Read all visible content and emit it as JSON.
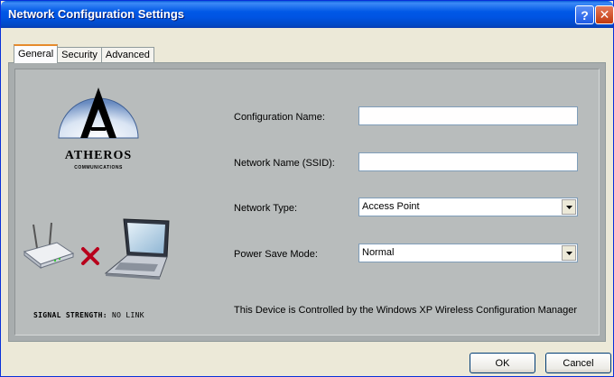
{
  "window": {
    "title": "Network Configuration Settings"
  },
  "tabs": [
    {
      "label": "General",
      "active": true
    },
    {
      "label": "Security",
      "active": false
    },
    {
      "label": "Advanced",
      "active": false
    }
  ],
  "brand": {
    "name": "ATHEROS",
    "tagline": "COMMUNICATIONS"
  },
  "signal": {
    "label": "SIGNAL STRENGTH:",
    "value": "NO LINK"
  },
  "form": {
    "config_name": {
      "label": "Configuration Name:",
      "value": ""
    },
    "ssid": {
      "label": "Network Name (SSID):",
      "value": ""
    },
    "network_type": {
      "label": "Network Type:",
      "selected": "Access Point"
    },
    "power_save": {
      "label": "Power Save Mode:",
      "selected": "Normal"
    }
  },
  "info": "This Device is Controlled by the Windows XP Wireless Configuration Manager",
  "buttons": {
    "ok": "OK",
    "cancel": "Cancel"
  },
  "colors": {
    "titlebar": "#0054e3",
    "panel": "#b8bcbc",
    "dialog": "#ece9d8",
    "x_mark": "#b8001c"
  },
  "icons": [
    "help-icon",
    "close-icon",
    "atheros-logo",
    "router-icon",
    "no-link-x-icon",
    "laptop-icon",
    "dropdown-arrow-icon"
  ]
}
